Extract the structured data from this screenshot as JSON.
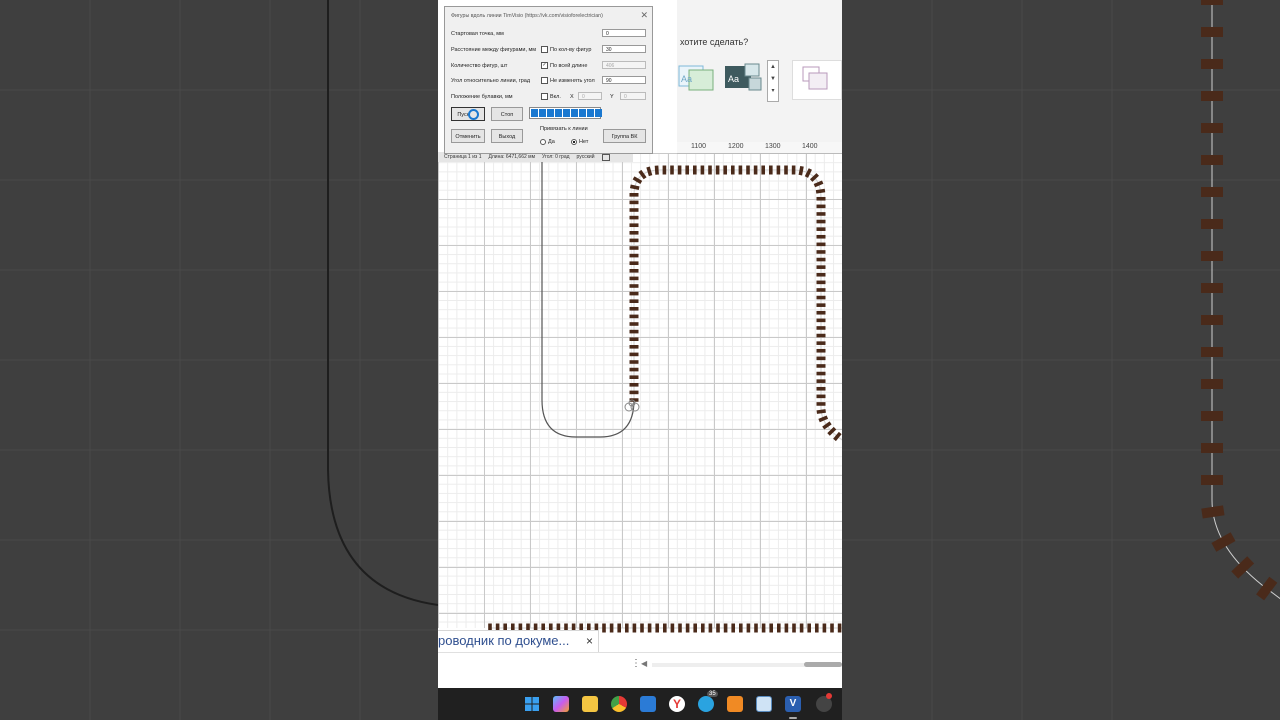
{
  "dialog": {
    "title": "Фигуры вдоль линии TimVisio (https://vk.com/visioforelectrician)",
    "rows": [
      {
        "label": "Стартовая точка, мм",
        "check_label": "",
        "checked": false,
        "value": "0",
        "disabled": false
      },
      {
        "label": "Расстояние между фигурами, мм",
        "check_label": "По кол-ву фигур",
        "checked": false,
        "value": "30",
        "disabled": false
      },
      {
        "label": "Количество фигур, шт",
        "check_label": "По всей длине",
        "checked": true,
        "value": "406",
        "disabled": true
      },
      {
        "label": "Угол относительно линии, град",
        "check_label": "Не изменять угол",
        "checked": false,
        "value": "90",
        "disabled": false
      },
      {
        "label": "Положение булавки, мм",
        "check_label": "Вкл.",
        "checked": false,
        "value": "",
        "disabled": false
      }
    ],
    "pin_x_label": "X",
    "pin_x_value": "0",
    "pin_y_label": "Y",
    "pin_y_value": "0",
    "start_label": "Пуск",
    "stop_label": "Стоп",
    "cancel_label": "Отменить",
    "exit_label": "Выход",
    "vk_group_label": "Группа ВК",
    "snap_label": "Привязать к линии",
    "snap_yes": "Да",
    "snap_no": "Нет",
    "progress_segments": 9
  },
  "status_bar": {
    "page": "Страница 1 из 1",
    "length": "Длина: 6471,662 мм",
    "angle": "Угол: 0 град",
    "language": "русский"
  },
  "ribbon": {
    "ask": "хотите сделать?"
  },
  "ruler": {
    "ticks": [
      "1100",
      "1200",
      "1300",
      "1400"
    ]
  },
  "doc_tab": {
    "label": "роводник по докуме...",
    "close": "×"
  },
  "taskbar": {
    "telegram_badge": "35"
  },
  "colors": {
    "progress": "#1a78d0",
    "tie": "#4a2a1a",
    "rail": "#cfcfcf",
    "taskbar": "#202020"
  }
}
